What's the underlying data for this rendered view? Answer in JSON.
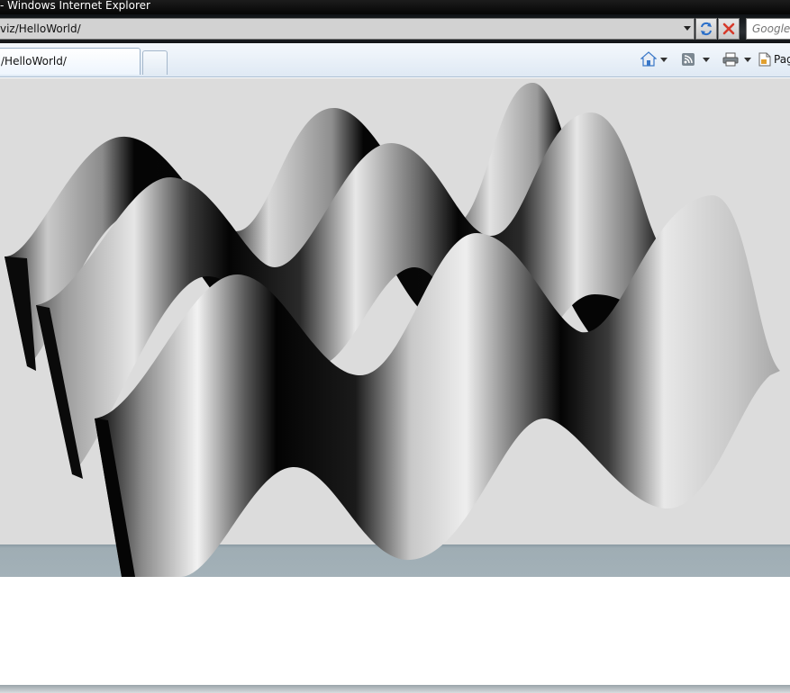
{
  "window": {
    "title": "- Windows Internet Explorer"
  },
  "address_bar": {
    "url": "viz/HelloWorld/"
  },
  "search": {
    "placeholder": "Google"
  },
  "tabs": [
    {
      "label": "/HelloWorld/"
    }
  ],
  "command_bar": {
    "page_label": "Page"
  },
  "icons": {
    "address_dropdown": "chevron-down-icon",
    "refresh": "refresh-icon",
    "stop": "close-icon",
    "home": "home-icon",
    "feeds": "rss-feed-icon",
    "print": "printer-icon",
    "page": "page-icon"
  },
  "colors": {
    "stop_icon": "#d63a2a",
    "refresh_icon": "#2a6fc9",
    "home_icon": "#3a78c8",
    "viewport_bg": "#dcdcdc",
    "footer_band": "#a3b1b8"
  }
}
